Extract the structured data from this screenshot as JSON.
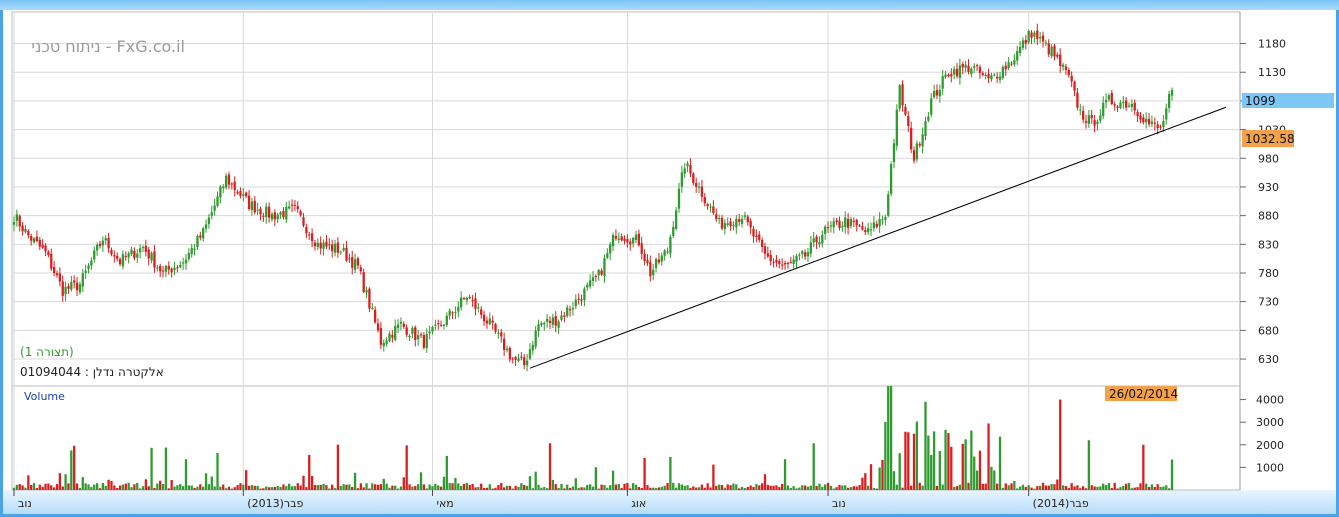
{
  "header": {
    "title": "ניתוח טכני - FxG.co.il",
    "view_label": "(תצורה 1)",
    "instrument": "01094044 : אלקטרה נדלן"
  },
  "colors": {
    "up": "#2e9b2e",
    "down": "#d81e1e",
    "frame": "#4aa3e6",
    "last_price_bg": "#7cc7f5",
    "support_bg": "#f3a24a",
    "date_bg": "#f3a24a",
    "grid": "#d9d9d9"
  },
  "chart_data": [
    {
      "type": "candlestick",
      "name": "price",
      "y_ticks": [
        630,
        680,
        730,
        780,
        830,
        880,
        930,
        980,
        1030,
        1080,
        1130,
        1180
      ],
      "ylim": [
        583,
        1235
      ],
      "x_labels": [
        "נוב",
        "פבר(2013)",
        "מאי",
        "אוג",
        "נוב",
        "פבר(2014)"
      ],
      "last_price": "1099",
      "support_value": "1032.58",
      "trendline": {
        "from": 614,
        "to": 1069
      },
      "anchors": [
        [
          0,
          880
        ],
        [
          5,
          845
        ],
        [
          11,
          815
        ],
        [
          17,
          750
        ],
        [
          23,
          760
        ],
        [
          31,
          840
        ],
        [
          37,
          800
        ],
        [
          45,
          825
        ],
        [
          52,
          780
        ],
        [
          59,
          800
        ],
        [
          66,
          850
        ],
        [
          74,
          945
        ],
        [
          82,
          900
        ],
        [
          90,
          880
        ],
        [
          98,
          890
        ],
        [
          106,
          830
        ],
        [
          114,
          820
        ],
        [
          120,
          790
        ],
        [
          128,
          660
        ],
        [
          135,
          690
        ],
        [
          143,
          660
        ],
        [
          150,
          695
        ],
        [
          158,
          740
        ],
        [
          166,
          690
        ],
        [
          174,
          630
        ],
        [
          178,
          620
        ],
        [
          183,
          690
        ],
        [
          190,
          700
        ],
        [
          196,
          730
        ],
        [
          204,
          775
        ],
        [
          210,
          850
        ],
        [
          218,
          835
        ],
        [
          222,
          780
        ],
        [
          228,
          820
        ],
        [
          234,
          970
        ],
        [
          240,
          920
        ],
        [
          246,
          865
        ],
        [
          254,
          880
        ],
        [
          262,
          810
        ],
        [
          269,
          790
        ],
        [
          276,
          810
        ],
        [
          282,
          850
        ],
        [
          290,
          870
        ],
        [
          298,
          850
        ],
        [
          304,
          880
        ],
        [
          309,
          1100
        ],
        [
          314,
          980
        ],
        [
          320,
          1080
        ],
        [
          326,
          1130
        ],
        [
          334,
          1140
        ],
        [
          340,
          1115
        ],
        [
          348,
          1150
        ],
        [
          355,
          1200
        ],
        [
          362,
          1165
        ],
        [
          368,
          1120
        ],
        [
          372,
          1060
        ],
        [
          376,
          1040
        ],
        [
          382,
          1080
        ],
        [
          390,
          1075
        ],
        [
          396,
          1040
        ],
        [
          400,
          1030
        ],
        [
          404,
          1099
        ]
      ]
    },
    {
      "type": "bar",
      "name": "volume",
      "title": "Volume",
      "y_ticks": [
        1000,
        2000,
        3000,
        4000
      ],
      "ylim": [
        0,
        4600
      ],
      "date_label": "26/02/2014"
    }
  ]
}
